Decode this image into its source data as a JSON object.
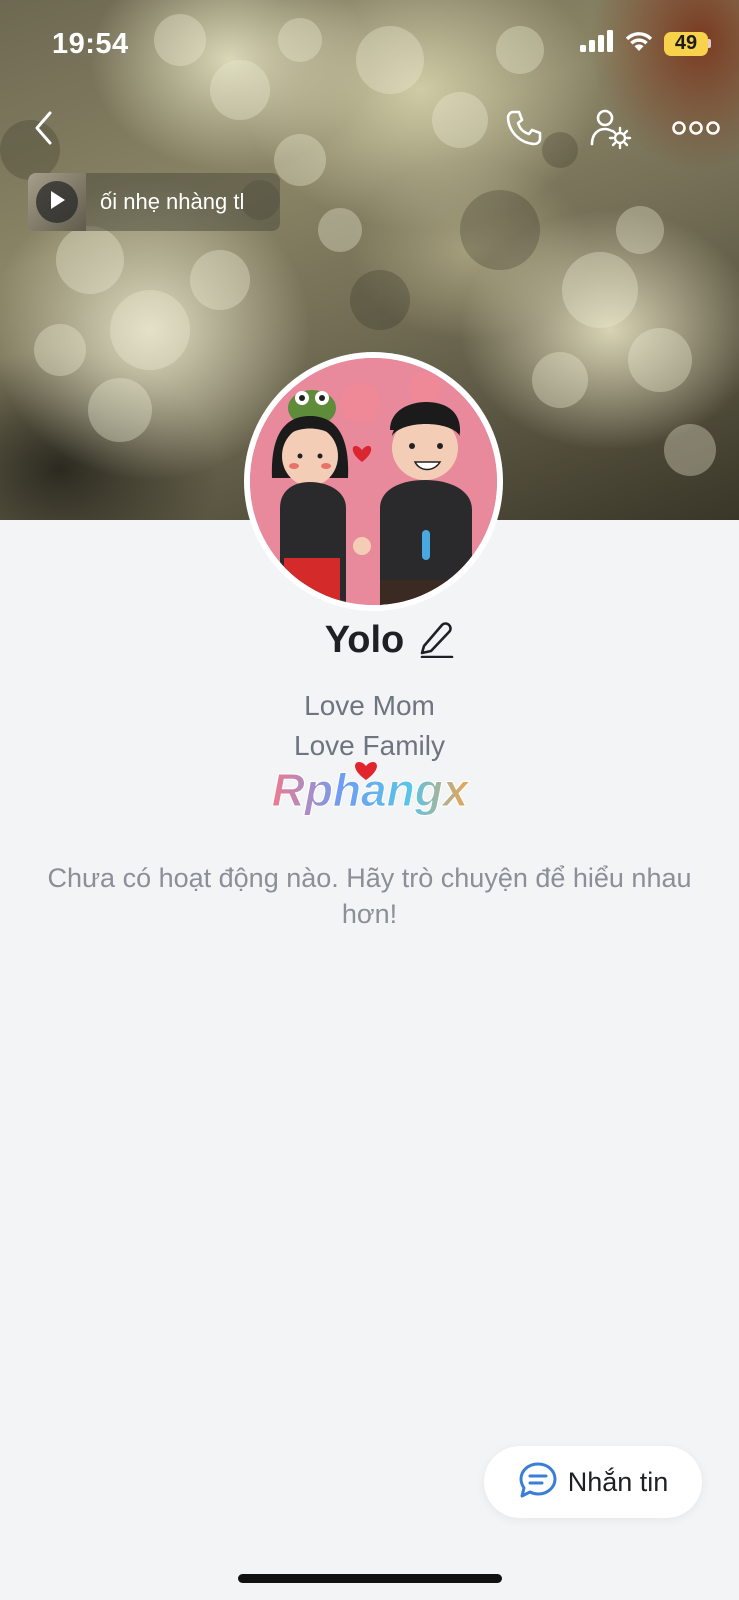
{
  "status_bar": {
    "time": "19:54",
    "battery": "49",
    "signal_icon": "cellular-signal-icon",
    "wifi_icon": "wifi-icon"
  },
  "nav": {
    "back_icon": "chevron-left-icon",
    "call_icon": "phone-icon",
    "settings_icon": "user-settings-icon",
    "more_icon": "more-horizontal-icon"
  },
  "music": {
    "song_text": "ối nhẹ nhàng tl",
    "play_icon": "play-icon"
  },
  "profile": {
    "name": "Yolo",
    "edit_icon": "pencil-icon",
    "bio_line1": "Love Mom",
    "bio_line2": "Love Family",
    "logo_text": "Rphangx"
  },
  "empty_state": {
    "message": "Chưa có hoạt động nào. Hãy trò chuyện để hiểu nhau hơn!"
  },
  "action": {
    "message_label": "Nhắn tin",
    "message_icon": "chat-bubble-icon"
  },
  "colors": {
    "background": "#f3f4f6",
    "accent_blue": "#3a7fd6",
    "battery_yellow": "#f7d24a",
    "text_dark": "#1e2124",
    "text_muted": "#8a8f98"
  }
}
